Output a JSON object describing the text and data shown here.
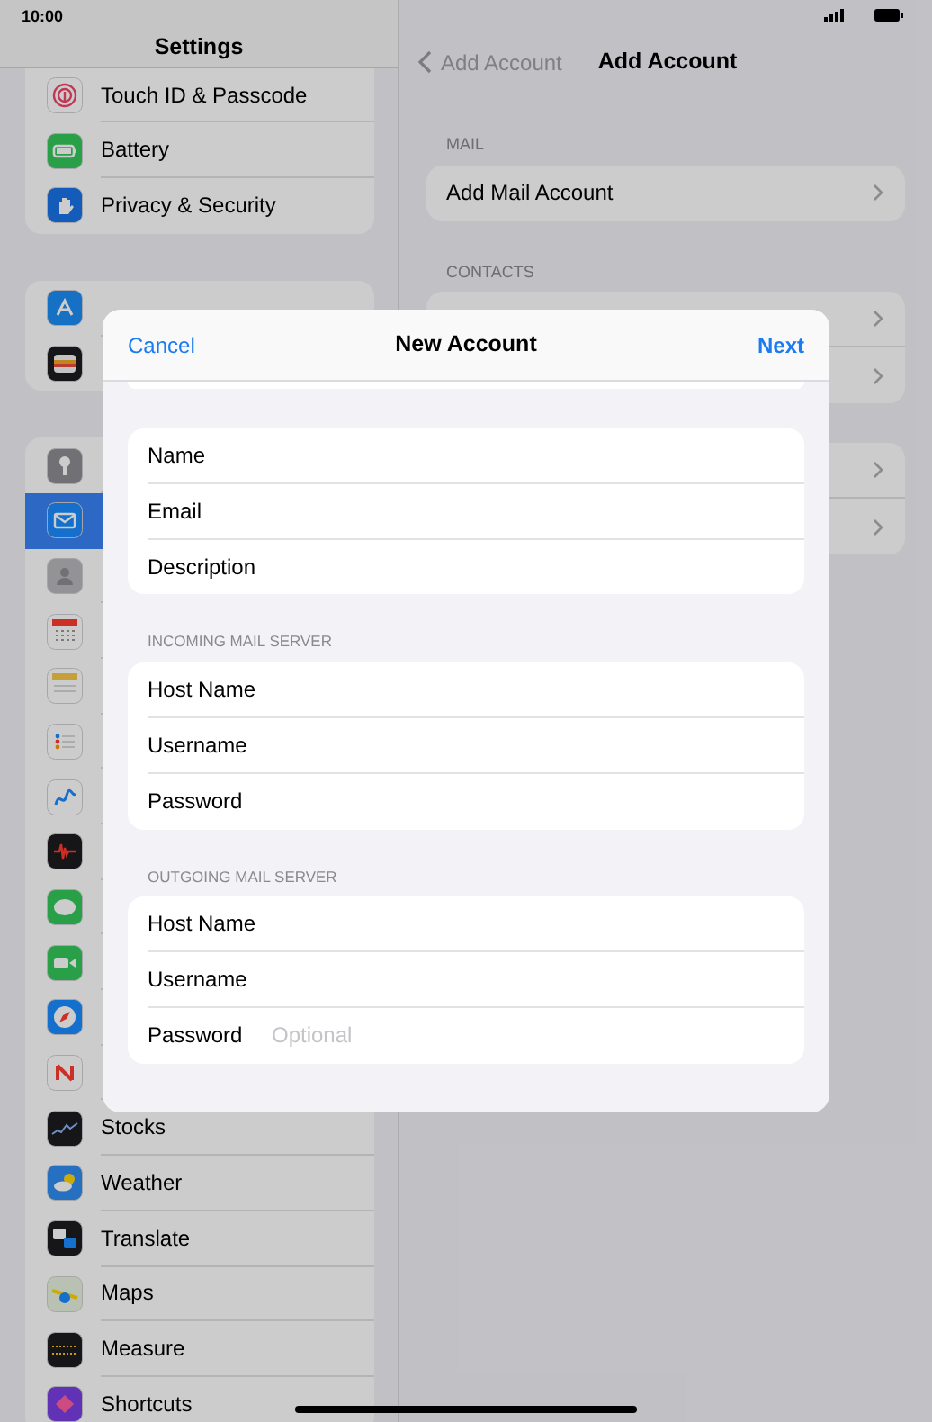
{
  "status_bar": {
    "time": "10:00"
  },
  "sidebar": {
    "title": "Settings",
    "groups": [
      {
        "items": [
          {
            "kind": "fingerprint",
            "label": "Touch ID & Passcode",
            "selected": false
          },
          {
            "kind": "battery",
            "label": "Battery",
            "selected": false
          },
          {
            "kind": "hand",
            "label": "Privacy & Security",
            "selected": false
          }
        ]
      },
      {
        "items": [
          {
            "kind": "appstore",
            "selected": false
          },
          {
            "kind": "wallet",
            "selected": false
          }
        ]
      },
      {
        "items": [
          {
            "kind": "key",
            "selected": false
          },
          {
            "kind": "mail",
            "selected": true
          },
          {
            "kind": "contacts",
            "selected": false
          },
          {
            "kind": "calendar",
            "selected": false
          },
          {
            "kind": "notes",
            "selected": false
          },
          {
            "kind": "reminders",
            "selected": false
          },
          {
            "kind": "freeform",
            "selected": false
          },
          {
            "kind": "voicememos",
            "selected": false
          },
          {
            "kind": "messages",
            "selected": false
          },
          {
            "kind": "facetime",
            "selected": false
          },
          {
            "kind": "safari",
            "selected": false
          },
          {
            "kind": "news",
            "selected": false
          },
          {
            "kind": "stocks",
            "label": "Stocks",
            "selected": false
          },
          {
            "kind": "weather",
            "label": "Weather",
            "selected": false
          },
          {
            "kind": "translate",
            "label": "Translate",
            "selected": false
          },
          {
            "kind": "maps",
            "label": "Maps",
            "selected": false
          },
          {
            "kind": "measure",
            "label": "Measure",
            "selected": false
          },
          {
            "kind": "shortcuts",
            "label": "Shortcuts",
            "selected": false
          }
        ]
      }
    ]
  },
  "detail": {
    "back": "Add Account",
    "title": "Add Account",
    "sections": [
      {
        "header": "MAIL",
        "rows": [
          {
            "label": "Add Mail Account"
          }
        ]
      },
      {
        "header": "CONTACTS",
        "rows": [
          {},
          {}
        ]
      },
      {
        "rows": [
          {},
          {}
        ]
      }
    ]
  },
  "dialog": {
    "cancel": "Cancel",
    "title": "New Account",
    "next": "Next",
    "groups": [
      {
        "fields": [
          {
            "label": "Name"
          },
          {
            "label": "Email"
          },
          {
            "label": "Description"
          }
        ]
      },
      {
        "header": "INCOMING MAIL SERVER",
        "fields": [
          {
            "label": "Host Name"
          },
          {
            "label": "Username"
          },
          {
            "label": "Password"
          }
        ]
      },
      {
        "header": "OUTGOING MAIL SERVER",
        "fields": [
          {
            "label": "Host Name"
          },
          {
            "label": "Username"
          },
          {
            "label": "Password",
            "placeholder": "Optional"
          }
        ]
      }
    ]
  }
}
